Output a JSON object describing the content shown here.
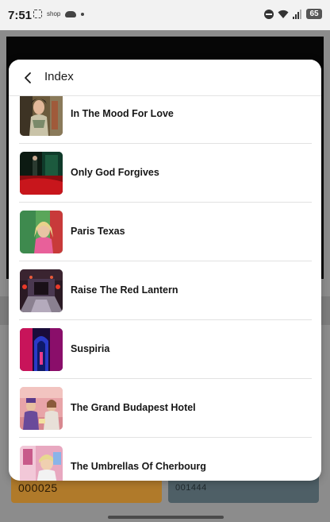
{
  "status_bar": {
    "time": "7:51",
    "notification_text": "shop",
    "battery": "65"
  },
  "background": {
    "card_left_value": "000025",
    "card_right_value": "001444"
  },
  "sheet": {
    "title": "Index",
    "items": [
      {
        "label": "In The Mood For Love",
        "thumb": "in-the-mood-for-love-thumbnail"
      },
      {
        "label": "Only God Forgives",
        "thumb": "only-god-forgives-thumbnail"
      },
      {
        "label": "Paris Texas",
        "thumb": "paris-texas-thumbnail"
      },
      {
        "label": "Raise The Red Lantern",
        "thumb": "raise-the-red-lantern-thumbnail"
      },
      {
        "label": "Suspiria",
        "thumb": "suspiria-thumbnail"
      },
      {
        "label": "The Grand Budapest Hotel",
        "thumb": "the-grand-budapest-hotel-thumbnail"
      },
      {
        "label": "The Umbrellas Of Cherbourg",
        "thumb": "the-umbrellas-of-cherbourg-thumbnail"
      }
    ]
  },
  "colors": {
    "scrim": "#8c8c8c",
    "sheet_bg": "#ffffff",
    "divider": "#e2e2e2",
    "card_orange": "#b07a2a",
    "card_slate": "#4e5f66"
  }
}
